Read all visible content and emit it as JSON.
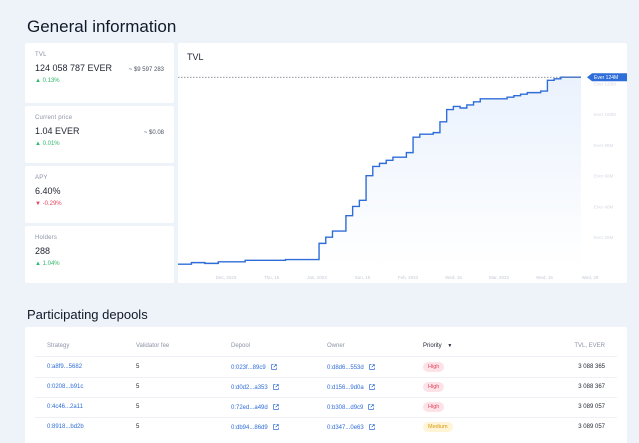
{
  "general": {
    "title": "General information",
    "stats": [
      {
        "label": "TVL",
        "value": "124 058 787  EVER",
        "usd": "~ $9 597 283",
        "change": "▲ 0.13%",
        "dir": "up"
      },
      {
        "label": "Current price",
        "value": "1.04  EVER",
        "usd": "~ $0.08",
        "change": "▲ 0.01%",
        "dir": "up"
      },
      {
        "label": "APY",
        "value": "6.40%",
        "usd": "",
        "change": "▼ -0.29%",
        "dir": "down"
      },
      {
        "label": "Holders",
        "value": "288",
        "usd": "",
        "change": "▲ 1.04%",
        "dir": "up"
      }
    ]
  },
  "tvl_chart": {
    "title": "TVL",
    "marker_label": "Ever 124M",
    "colors": {
      "line": "#2f6dd9",
      "fill": "#eaf2fd",
      "label": "#2f6dd9"
    }
  },
  "chart_data": {
    "type": "area",
    "title": "TVL",
    "x_tick_labels": [
      "Dec, 2023",
      "Thu, 15",
      "Jan, 2023",
      "Sun, 15",
      "Feb, 2023",
      "Wed, 15",
      "Mar, 2023",
      "Wed, 15",
      "Wed, 29"
    ],
    "y_tick_labels": [
      "Ever 20M",
      "Ever 40M",
      "Ever 60M",
      "Ever 80M",
      "Ever 100M",
      "Ever 120M"
    ],
    "ylim": [
      0,
      130
    ],
    "x": [
      0,
      2,
      4,
      6,
      8,
      10,
      12,
      14,
      16,
      18,
      20,
      21,
      22,
      23,
      24,
      25,
      26,
      27,
      28,
      29,
      30,
      31,
      32,
      33,
      34,
      35,
      36,
      37,
      38,
      39,
      40,
      41,
      42,
      43,
      44,
      45,
      46,
      47,
      48,
      49,
      50,
      51,
      52,
      53,
      54,
      55,
      56,
      57,
      58,
      59,
      60
    ],
    "values": [
      2.5,
      3.5,
      3,
      4,
      4,
      5,
      5,
      5,
      5.5,
      5.5,
      5.5,
      16,
      20,
      24,
      24,
      34,
      40,
      44,
      60,
      66,
      68,
      70,
      72,
      72,
      75,
      85,
      87,
      87,
      88,
      95,
      103,
      105,
      104,
      106,
      108,
      110,
      110,
      110,
      110,
      111,
      112,
      113,
      114,
      114,
      115,
      122,
      123,
      124,
      124,
      124,
      124
    ],
    "markers": [
      {
        "y": 124,
        "label": "Ever 124M"
      }
    ],
    "grid": false,
    "legend": "none"
  },
  "depools": {
    "title": "Participating depools",
    "columns": [
      "Strategy",
      "Validator fee",
      "Depool",
      "Owner",
      "Priority",
      "TVL, EVER"
    ],
    "sort_indicator": "▼",
    "rows": [
      {
        "strategy": "0:a8f9...5682",
        "fee": "5",
        "depool": "0:023f...89c9",
        "owner": "0:d8d6...553d",
        "priority": "High",
        "priority_level": "high",
        "tvl": "3 088 365"
      },
      {
        "strategy": "0:0208...b91c",
        "fee": "5",
        "depool": "0:d0d2...a353",
        "owner": "0:d156...9d0a",
        "priority": "High",
        "priority_level": "high",
        "tvl": "3 088 367"
      },
      {
        "strategy": "0:4c46...2a11",
        "fee": "5",
        "depool": "0:72ed...a49d",
        "owner": "0:b308...d9c9",
        "priority": "High",
        "priority_level": "high",
        "tvl": "3 089 057"
      },
      {
        "strategy": "0:8918...bd2b",
        "fee": "5",
        "depool": "0:db94...86d9",
        "owner": "0:d347...0e63",
        "priority": "Medium",
        "priority_level": "medium",
        "tvl": "3 089 057"
      }
    ]
  }
}
